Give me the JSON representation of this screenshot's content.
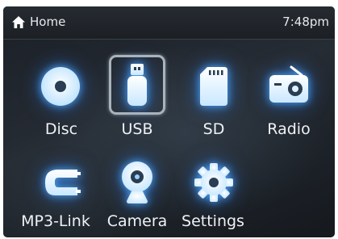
{
  "statusbar": {
    "title": "Home",
    "time": "7:48pm",
    "icon": "home-icon"
  },
  "menu": {
    "selected": "USB",
    "items": [
      {
        "id": "disc",
        "label": "Disc",
        "icon": "disc-icon"
      },
      {
        "id": "usb",
        "label": "USB",
        "icon": "usb-icon"
      },
      {
        "id": "sd",
        "label": "SD",
        "icon": "sd-card-icon"
      },
      {
        "id": "radio",
        "label": "Radio",
        "icon": "radio-icon"
      },
      {
        "id": "mp3link",
        "label": "MP3-Link",
        "icon": "mp3-link-icon"
      },
      {
        "id": "camera",
        "label": "Camera",
        "icon": "camera-icon"
      },
      {
        "id": "settings",
        "label": "Settings",
        "icon": "gear-icon"
      }
    ]
  },
  "colors": {
    "icon_glow": "#7fc6ff",
    "icon_fill": "#dff1ff",
    "text": "#eef2f6",
    "background": "#1f242b"
  }
}
